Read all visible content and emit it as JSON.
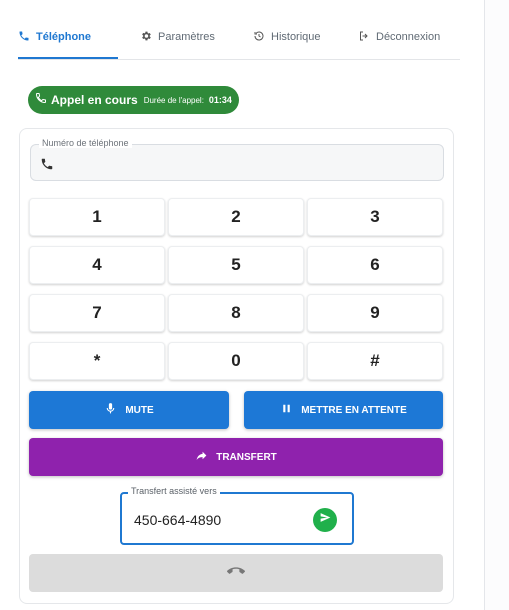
{
  "tabs": [
    {
      "label": "Téléphone",
      "icon": "phone-icon",
      "active": true
    },
    {
      "label": "Paramètres",
      "icon": "gear-icon",
      "active": false
    },
    {
      "label": "Historique",
      "icon": "history-icon",
      "active": false
    },
    {
      "label": "Déconnexion",
      "icon": "logout-icon",
      "active": false
    }
  ],
  "call_status": {
    "label": "Appel en cours",
    "duration_label": "Durée de l'appel:",
    "duration": "01:34",
    "color": "#2f8a3a"
  },
  "phone_input": {
    "label": "Numéro de téléphone",
    "value": ""
  },
  "keypad": [
    "1",
    "2",
    "3",
    "4",
    "5",
    "6",
    "7",
    "8",
    "9",
    "*",
    "0",
    "#"
  ],
  "actions": {
    "mute": "MUTE",
    "hold": "METTRE EN ATTENTE",
    "transfer": "TRANSFERT"
  },
  "assisted_transfer": {
    "label": "Transfert assisté vers",
    "value": "450-664-4890"
  },
  "colors": {
    "accent": "#1f78d1",
    "primary_button": "#1d78d6",
    "transfer_button": "#8f22ad",
    "send_button": "#20b04b",
    "hangup_button": "#dcdcdc"
  }
}
